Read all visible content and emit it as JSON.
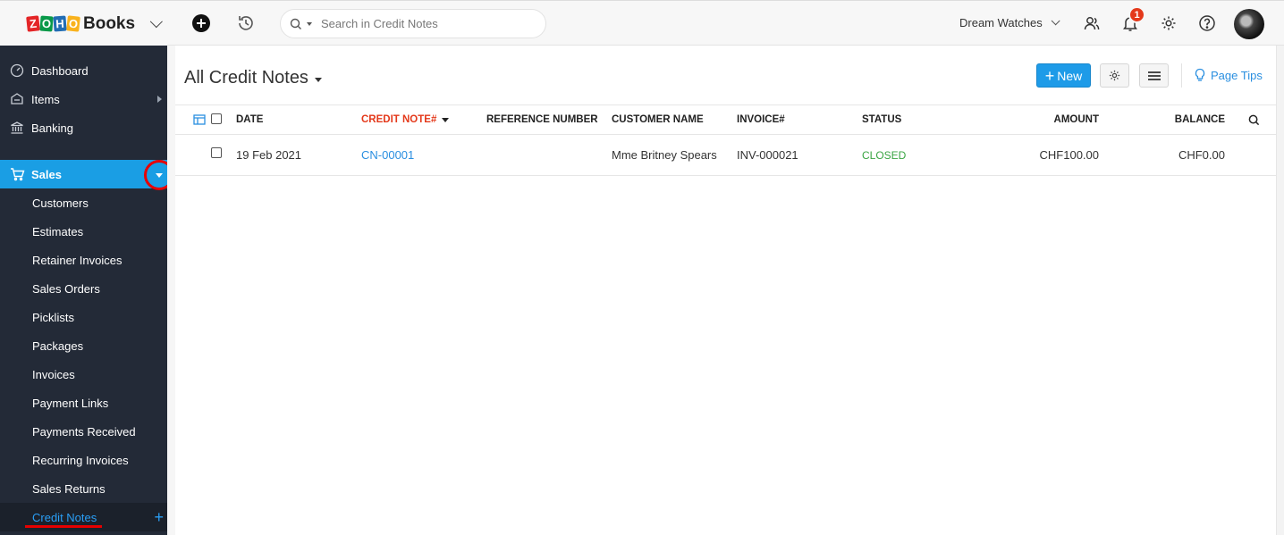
{
  "brand": {
    "letters": [
      "Z",
      "O",
      "H",
      "O"
    ],
    "name": "Books"
  },
  "topbar": {
    "search_placeholder": "Search in Credit Notes",
    "org_name": "Dream Watches",
    "notification_count": "1",
    "icons": [
      "plus-circle-icon",
      "history-icon",
      "users-icon",
      "bell-icon",
      "gear-icon",
      "help-icon"
    ]
  },
  "sidebar": {
    "top_items": [
      {
        "label": "Dashboard",
        "icon": "dashboard-icon"
      },
      {
        "label": "Items",
        "icon": "tag-icon"
      },
      {
        "label": "Banking",
        "icon": "bank-icon"
      }
    ],
    "sales": {
      "label": "Sales",
      "icon": "cart-icon"
    },
    "sales_items": [
      "Customers",
      "Estimates",
      "Retainer Invoices",
      "Sales Orders",
      "Picklists",
      "Packages",
      "Invoices",
      "Payment Links",
      "Payments Received",
      "Recurring Invoices",
      "Sales Returns",
      "Credit Notes"
    ],
    "active_item": "Credit Notes"
  },
  "main": {
    "title": "All Credit Notes",
    "new_label": "New",
    "page_tips_label": "Page Tips",
    "columns": {
      "date": "DATE",
      "credit_note": "CREDIT NOTE#",
      "reference": "REFERENCE NUMBER",
      "customer": "CUSTOMER NAME",
      "invoice": "INVOICE#",
      "status": "STATUS",
      "amount": "AMOUNT",
      "balance": "BALANCE"
    },
    "rows": [
      {
        "date": "19 Feb 2021",
        "credit_note": "CN-00001",
        "reference": "",
        "customer": "Mme Britney Spears",
        "invoice": "INV-000021",
        "status": "CLOSED",
        "amount": "CHF100.00",
        "balance": "CHF0.00"
      }
    ]
  },
  "colors": {
    "accent": "#1a9ee4",
    "status_closed": "#3aa543",
    "sorted_header": "#e4391b",
    "annotation": "#e60000"
  }
}
